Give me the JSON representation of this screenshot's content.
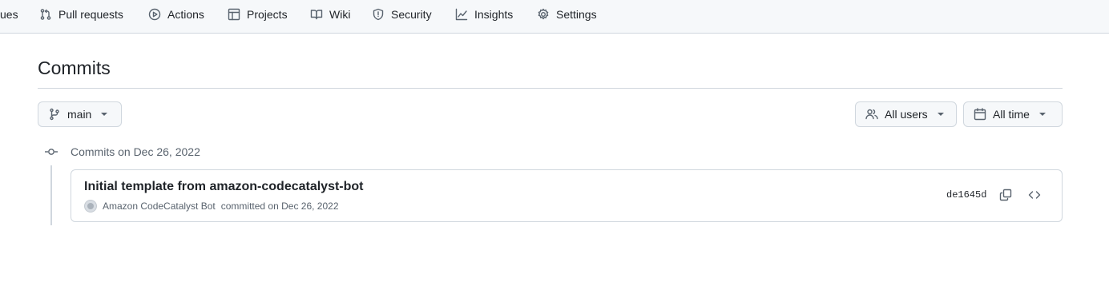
{
  "repo_nav": {
    "items": [
      {
        "label": "ues",
        "icon": "issues-icon"
      },
      {
        "label": "Pull requests",
        "icon": "pull-request-icon"
      },
      {
        "label": "Actions",
        "icon": "play-icon"
      },
      {
        "label": "Projects",
        "icon": "table-icon"
      },
      {
        "label": "Wiki",
        "icon": "book-icon"
      },
      {
        "label": "Security",
        "icon": "shield-icon"
      },
      {
        "label": "Insights",
        "icon": "graph-icon"
      },
      {
        "label": "Settings",
        "icon": "gear-icon"
      }
    ]
  },
  "page": {
    "title": "Commits"
  },
  "filters": {
    "branch": "main",
    "users": "All users",
    "time": "All time"
  },
  "commit_groups": [
    {
      "heading": "Commits on Dec 26, 2022",
      "commits": [
        {
          "title": "Initial template from amazon-codecatalyst-bot",
          "author": "Amazon CodeCatalyst Bot",
          "action": "committed on Dec 26, 2022",
          "sha": "de1645d"
        }
      ]
    }
  ],
  "colors": {
    "nav_background": "#f6f8fa",
    "border": "#d0d7de",
    "text_primary": "#1f2328",
    "text_muted": "#59636e"
  }
}
